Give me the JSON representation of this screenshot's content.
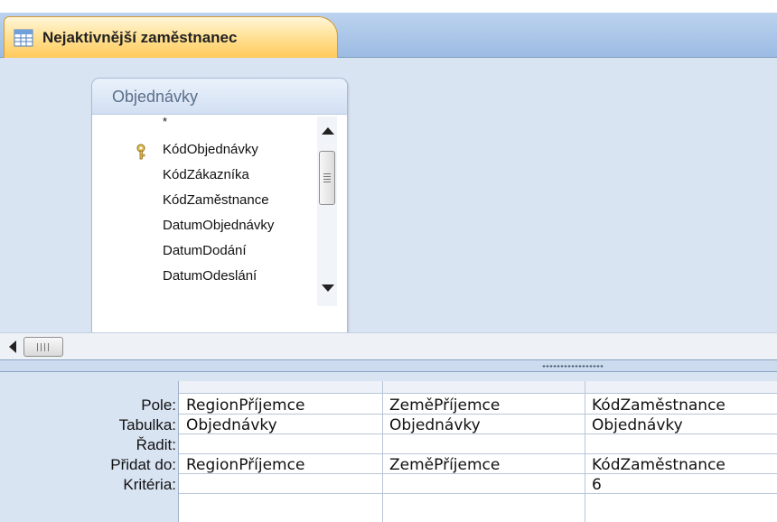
{
  "top_fragment": "",
  "tab": {
    "title": "Nejaktivnější zaměstnanec",
    "icon": "query-design-icon",
    "accent": "#ffd77a"
  },
  "table_box": {
    "title": "Objednávky",
    "fields": [
      {
        "label": "*",
        "primary_key": false
      },
      {
        "label": "KódObjednávky",
        "primary_key": true
      },
      {
        "label": "KódZákazníka",
        "primary_key": false
      },
      {
        "label": "KódZaměstnance",
        "primary_key": false
      },
      {
        "label": "DatumObjednávky",
        "primary_key": false
      },
      {
        "label": "DatumDodání",
        "primary_key": false
      },
      {
        "label": "DatumOdeslání",
        "primary_key": false
      }
    ]
  },
  "grid": {
    "row_labels": {
      "field": "Pole:",
      "table": "Tabulka:",
      "sort": "Řadit:",
      "append_to": "Přidat do:",
      "criteria": "Kritéria:"
    },
    "columns": [
      {
        "field": "RegionPříjemce",
        "table": "Objednávky",
        "sort": "",
        "append_to": "RegionPříjemce",
        "criteria": ""
      },
      {
        "field": "ZeměPříjemce",
        "table": "Objednávky",
        "sort": "",
        "append_to": "ZeměPříjemce",
        "criteria": ""
      },
      {
        "field": "KódZaměstnance",
        "table": "Objednávky",
        "sort": "",
        "append_to": "KódZaměstnance",
        "criteria": "6"
      }
    ]
  },
  "colors": {
    "pane_background": "#d9e4f3",
    "tab_bar": "#a9c4e8",
    "tab_active": "#ffd77a"
  }
}
